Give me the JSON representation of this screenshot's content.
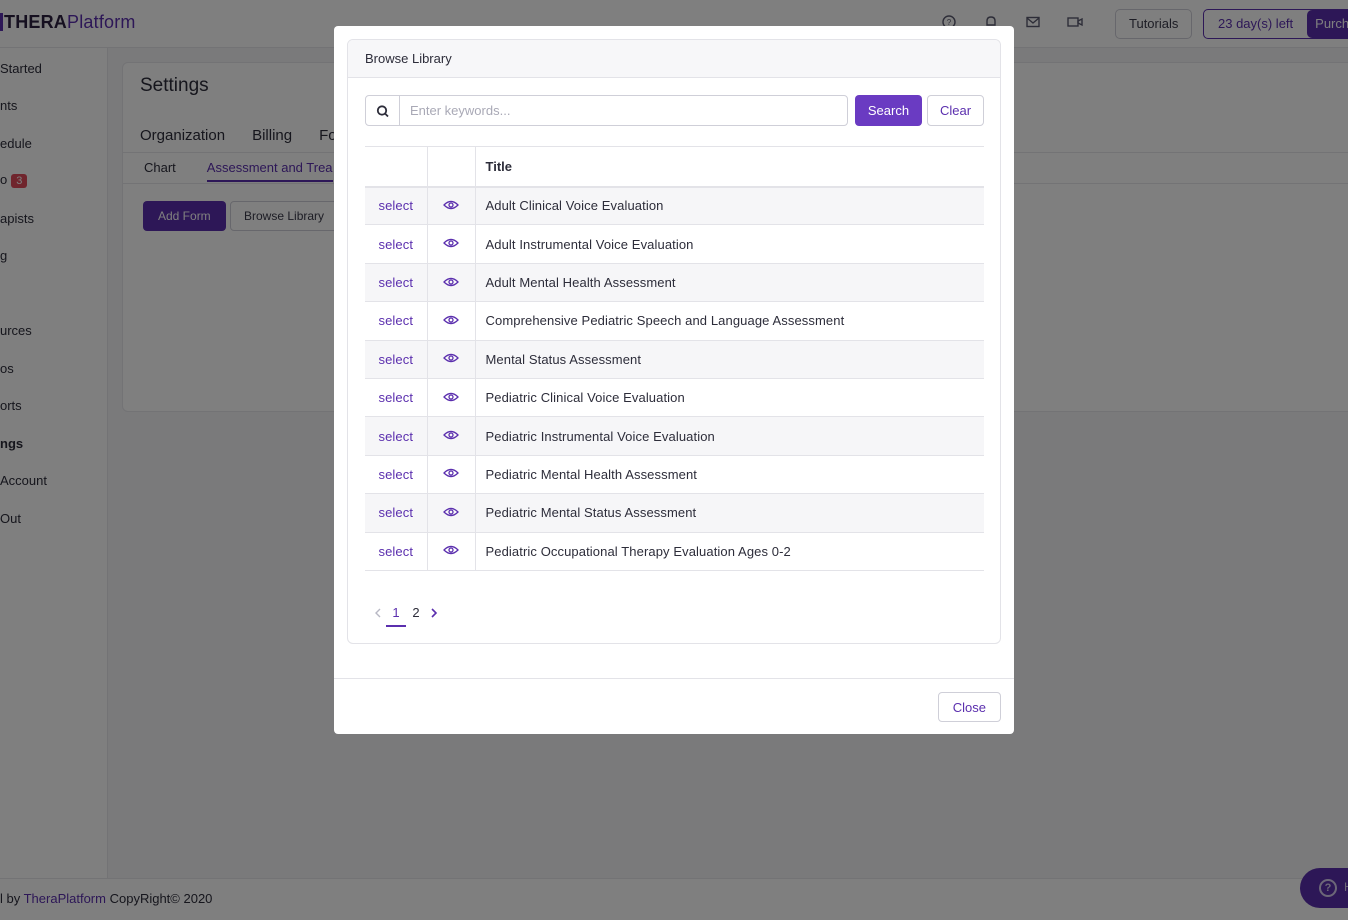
{
  "header": {
    "logo_bold": "THERA",
    "logo_rest": "Platform",
    "icons": [
      "help-icon",
      "bell-icon",
      "mail-icon",
      "video-icon"
    ],
    "tutorials_label": "Tutorials",
    "trial_label": "23 day(s) left",
    "purchase_label": "Purch"
  },
  "sidebar": {
    "items": [
      {
        "label": "Started"
      },
      {
        "label": "nts"
      },
      {
        "label": "edule"
      },
      {
        "label": "o",
        "badge": "3"
      },
      {
        "label": "apists"
      },
      {
        "label": "g"
      },
      {
        "label": ""
      },
      {
        "label": "urces"
      },
      {
        "label": "os"
      },
      {
        "label": "orts"
      },
      {
        "label": "ngs"
      },
      {
        "label": "Account"
      },
      {
        "label": " Out"
      }
    ]
  },
  "settings": {
    "title": "Settings",
    "tabs": [
      "Organization",
      "Billing",
      "Fo"
    ],
    "subtabs": [
      "Chart",
      "Assessment and Trea"
    ],
    "add_form_label": "Add Form",
    "browse_library_label": "Browse Library"
  },
  "footer": {
    "prefix": "l by ",
    "brand": "TheraPlatform",
    "suffix": " CopyRight© 2020"
  },
  "help": {
    "label": "H"
  },
  "modal": {
    "title": "Browse Library",
    "search_placeholder": "Enter keywords...",
    "search_value": "",
    "search_label": "Search",
    "clear_label": "Clear",
    "column_title": "Title",
    "select_label": "select",
    "rows": [
      "Adult Clinical Voice Evaluation",
      "Adult Instrumental Voice Evaluation",
      "Adult Mental Health Assessment",
      "Comprehensive Pediatric Speech and Language Assessment",
      "Mental Status Assessment",
      "Pediatric Clinical Voice Evaluation",
      "Pediatric Instrumental Voice Evaluation",
      "Pediatric Mental Health Assessment",
      "Pediatric Mental Status Assessment",
      "Pediatric Occupational Therapy Evaluation Ages 0-2"
    ],
    "pages": [
      "1",
      "2"
    ],
    "current_page": "1",
    "close_label": "Close"
  },
  "colors": {
    "accent": "#5b2fae",
    "badge": "#e04b5a"
  }
}
